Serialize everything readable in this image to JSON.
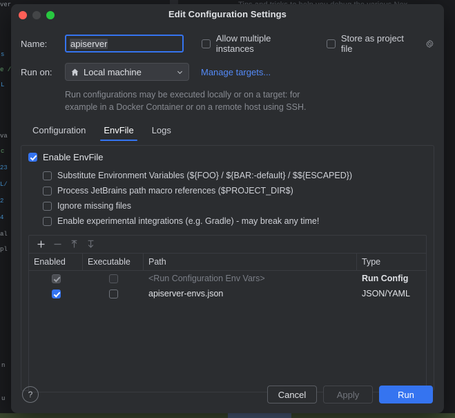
{
  "background": {
    "top_text": "Tips and tricks to help you debug the various Nex",
    "left_tokens": [
      "ver",
      "s",
      "e /",
      "L",
      "va",
      "c",
      "23",
      "L/",
      "2",
      "4",
      "al",
      "pl",
      "n",
      "u"
    ]
  },
  "window": {
    "title": "Edit Configuration Settings",
    "controls": {
      "close": "close-button",
      "minimize": "minimize-button",
      "zoom": "zoom-button"
    }
  },
  "form": {
    "name_label": "Name:",
    "name_value": "apiserver",
    "allow_multiple_label": "Allow multiple instances",
    "allow_multiple_checked": false,
    "store_project_label": "Store as project file",
    "store_project_checked": false,
    "run_on_label": "Run on:",
    "run_on_value": "Local machine",
    "manage_targets_link": "Manage targets...",
    "hint_line1": "Run configurations may be executed locally or on a target: for",
    "hint_line2": "example in a Docker Container or on a remote host using SSH."
  },
  "tabs": [
    {
      "label": "Configuration",
      "active": false
    },
    {
      "label": "EnvFile",
      "active": true
    },
    {
      "label": "Logs",
      "active": false
    }
  ],
  "envfile": {
    "enable_label": "Enable EnvFile",
    "enable_checked": true,
    "options": [
      {
        "label": "Substitute Environment Variables (${FOO} / ${BAR:-default} / $${ESCAPED})",
        "checked": false
      },
      {
        "label": "Process JetBrains path macro references ($PROJECT_DIR$)",
        "checked": false
      },
      {
        "label": "Ignore missing files",
        "checked": false
      },
      {
        "label": "Enable experimental integrations (e.g. Gradle) - may break any time!",
        "checked": false
      }
    ],
    "toolbar": [
      {
        "name": "add-button",
        "glyph": "plus",
        "enabled": true
      },
      {
        "name": "remove-button",
        "glyph": "minus",
        "enabled": false
      },
      {
        "name": "move-up-button",
        "glyph": "arrow-up",
        "enabled": false
      },
      {
        "name": "move-down-button",
        "glyph": "arrow-down",
        "enabled": false
      }
    ],
    "table": {
      "columns": [
        "Enabled",
        "Executable",
        "Path",
        "Type"
      ],
      "rows": [
        {
          "enabled": true,
          "enabled_disabled": true,
          "executable": false,
          "executable_disabled": true,
          "path": "<Run Configuration Env Vars>",
          "path_dim": true,
          "type": "Run Config",
          "type_bold": true
        },
        {
          "enabled": true,
          "enabled_disabled": false,
          "executable": false,
          "executable_disabled": false,
          "path": "apiserver-envs.json",
          "path_dim": false,
          "type": "JSON/YAML",
          "type_bold": false
        }
      ]
    }
  },
  "footer": {
    "help_label": "?",
    "cancel_label": "Cancel",
    "apply_label": "Apply",
    "run_label": "Run"
  },
  "colors": {
    "accent": "#3574f0",
    "link": "#548af7",
    "dialog_bg": "#2b2d30",
    "text": "#dfe1e5",
    "muted": "#878a91"
  }
}
